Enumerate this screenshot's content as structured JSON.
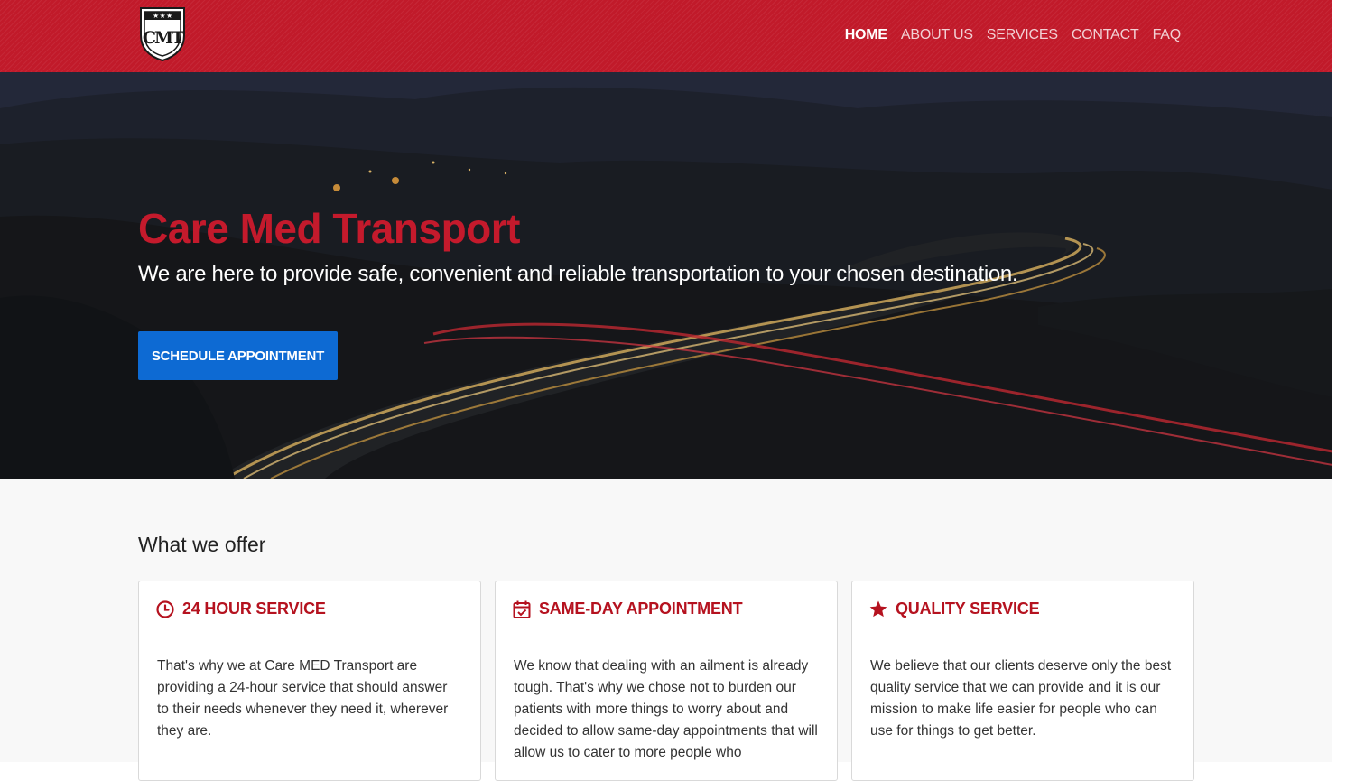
{
  "header": {
    "logo_text": "CMT",
    "nav": [
      {
        "label": "HOME",
        "active": true
      },
      {
        "label": "ABOUT US",
        "active": false
      },
      {
        "label": "SERVICES",
        "active": false
      },
      {
        "label": "CONTACT",
        "active": false
      },
      {
        "label": "FAQ",
        "active": false
      }
    ]
  },
  "hero": {
    "title": "Care Med Transport",
    "subtitle": "We are here to provide safe, convenient and reliable transportation to your chosen destination.",
    "cta_label": "SCHEDULE APPOINTMENT"
  },
  "offer": {
    "title": "What we offer",
    "cards": [
      {
        "icon": "clock-icon",
        "title": "24 HOUR SERVICE",
        "text": "That's why we at Care MED Transport are providing a 24-hour service that should answer to their needs whenever they need it, wherever they are."
      },
      {
        "icon": "calendar-check-icon",
        "title": "SAME-DAY APPOINTMENT",
        "text": "We know that dealing with an ailment is already tough. That's why we chose not to burden our patients with more things to worry about and decided to allow same-day appointments that will allow us to cater to more people who"
      },
      {
        "icon": "star-icon",
        "title": "QUALITY SERVICE",
        "text": "We believe that our clients deserve only the best quality service that we can provide and it is our mission to make life easier for people who can use for things to get better."
      }
    ]
  },
  "colors": {
    "brand_red": "#c11a2a",
    "cta_blue": "#0d6ad3"
  }
}
